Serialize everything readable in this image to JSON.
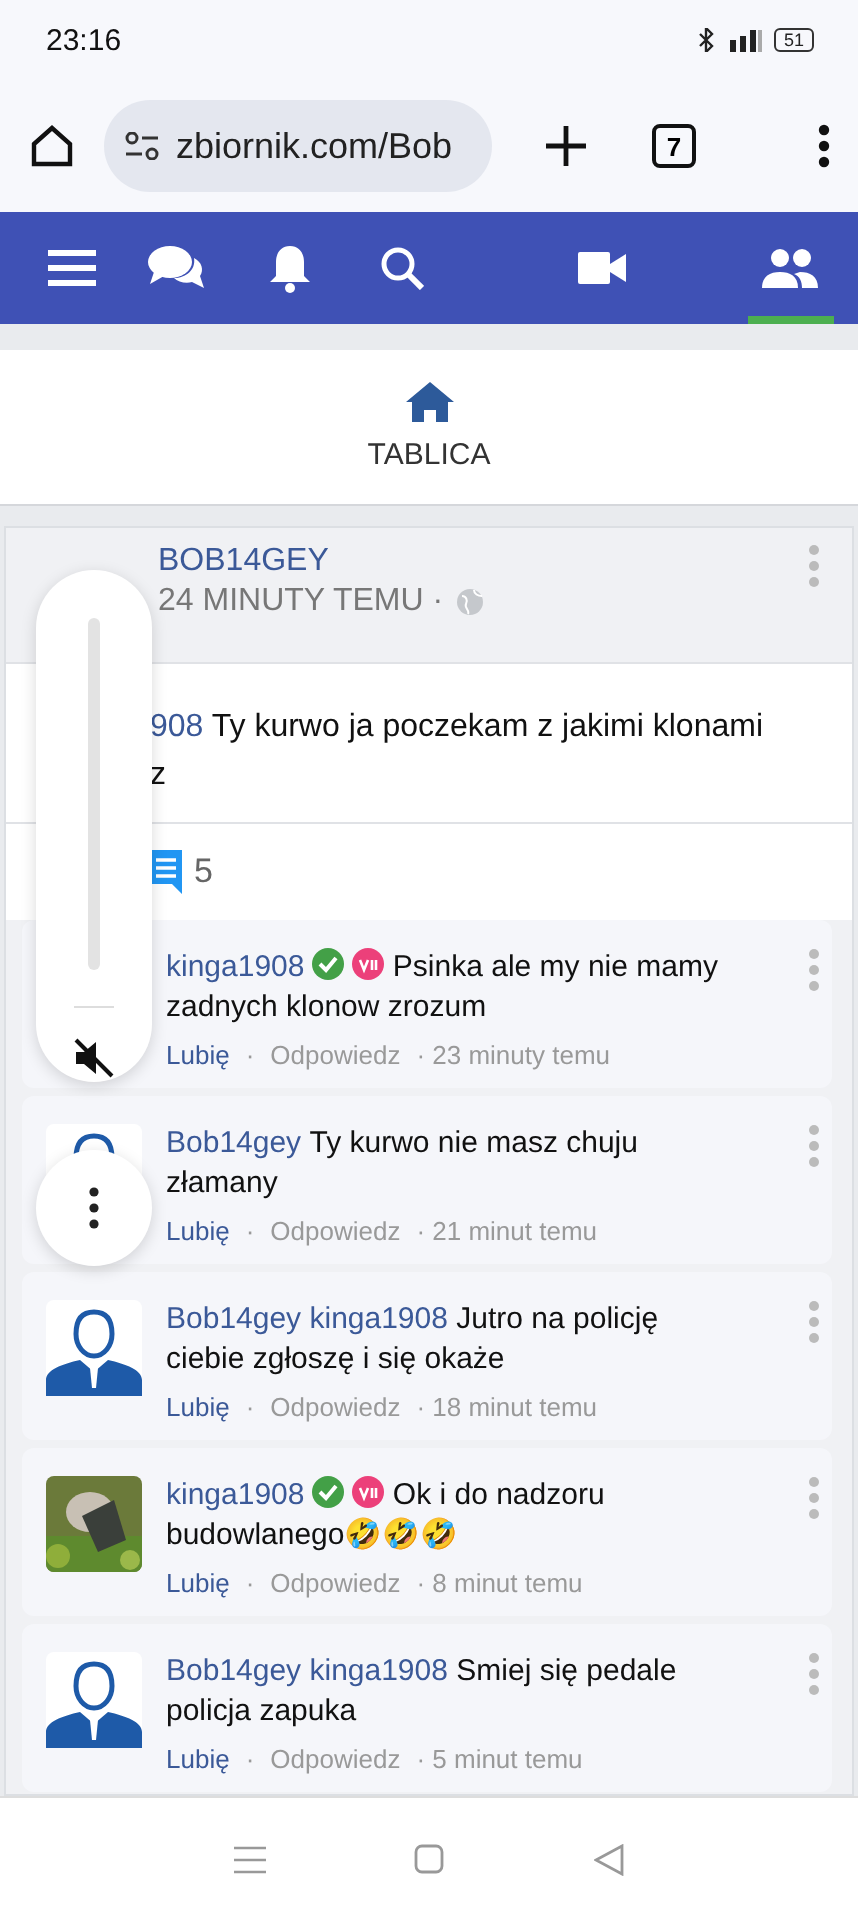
{
  "status_bar": {
    "time": "23:16",
    "battery": "51"
  },
  "browser": {
    "url": "zbiornik.com/Bob",
    "tab_count": "7"
  },
  "nav": {
    "items": [
      {
        "kind": "menu",
        "selected": false
      },
      {
        "kind": "chat",
        "selected": false
      },
      {
        "kind": "bell",
        "selected": false
      },
      {
        "kind": "search",
        "selected": false
      },
      {
        "kind": "video",
        "selected": false
      },
      {
        "kind": "people",
        "selected": true
      }
    ]
  },
  "section_tab": {
    "label": "TABLICA"
  },
  "post": {
    "author": "BOB14GEY",
    "time": "24 MINUTY TEMU ·",
    "body_lines": [
      {
        "mention": "908",
        "text": "Ty kurwo ja poczekam z jakimi klonami"
      },
      {
        "text": "z"
      }
    ],
    "comment_count": "5"
  },
  "comments": [
    {
      "authors": [
        "kinga1908"
      ],
      "verified": true,
      "vip": true,
      "text": "Psinka ale my nie mamy zadnych klonow zrozum",
      "like": "Lubię",
      "separator": "·",
      "reply": "Odpowiedz",
      "time": "· 23 minuty temu"
    },
    {
      "avatar": {
        "kind": "silhouette"
      },
      "authors": [
        "Bob14gey"
      ],
      "verified": false,
      "vip": false,
      "text": "Ty kurwo nie masz chuju złamany",
      "like": "Lubię",
      "separator": "·",
      "reply": "Odpowiedz",
      "time": "· 21 minut temu"
    },
    {
      "avatar": {
        "kind": "silhouette"
      },
      "authors": [
        "Bob14gey",
        "kinga1908"
      ],
      "verified": false,
      "vip": false,
      "text": "Jutro na policję ciebie zgłoszę i się okaże",
      "like": "Lubię",
      "separator": "·",
      "reply": "Odpowiedz",
      "time": "· 18 minut temu"
    },
    {
      "avatar": {
        "kind": "picture"
      },
      "authors": [
        "kinga1908"
      ],
      "verified": true,
      "vip": true,
      "text": "Ok i do nadzoru budowlanego🤣🤣🤣",
      "like": "Lubię",
      "separator": "·",
      "reply": "Odpowiedz",
      "time": "· 8 minut temu"
    },
    {
      "avatar": {
        "kind": "silhouette"
      },
      "authors": [
        "Bob14gey",
        "kinga1908"
      ],
      "verified": false,
      "vip": false,
      "text": "Smiej się pedale policja zapuka",
      "like": "Lubię",
      "separator": "·",
      "reply": "Odpowiedz",
      "time": "· 5 minut temu"
    }
  ],
  "volume_panel": {
    "muted": true,
    "level": 0
  }
}
